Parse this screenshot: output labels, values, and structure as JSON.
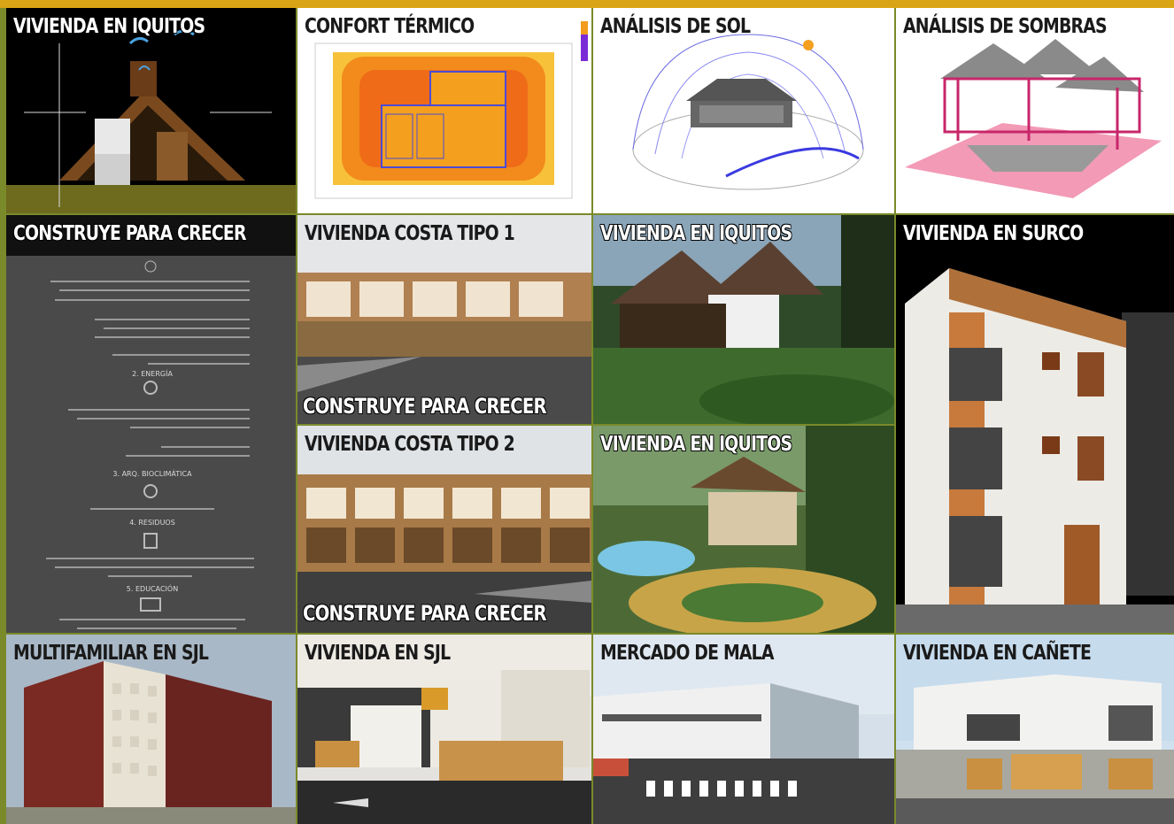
{
  "tiles": {
    "t1": {
      "title": "VIVIENDA EN IQUITOS"
    },
    "t2": {
      "title": "CONFORT TÉRMICO"
    },
    "t3": {
      "title": "ANÁLISIS DE SOL"
    },
    "t4": {
      "title": "ANÁLISIS DE SOMBRAS"
    },
    "t5": {
      "title": "CONSTRUYE PARA CRECER",
      "sections": [
        "2. ENERGÍA",
        "3. ARQ. BIOCLIMÁTICA",
        "4. RESIDUOS",
        "5. EDUCACIÓN"
      ]
    },
    "t6": {
      "title": "VIVIENDA COSTA TIPO 1",
      "caption": "CONSTRUYE PARA CRECER"
    },
    "t7": {
      "title": "VIVIENDA EN IQUITOS"
    },
    "t8": {
      "title": "VIVIENDA EN SURCO"
    },
    "t9": {
      "title": "VIVIENDA COSTA TIPO 2",
      "caption": "CONSTRUYE PARA CRECER"
    },
    "t10": {
      "title": "VIVIENDA EN IQUITOS"
    },
    "t11": {
      "title": "MULTIFAMILIAR EN SJL"
    },
    "t12": {
      "title": "VIVIENDA EN SJL"
    },
    "t13": {
      "title": "MERCADO DE MALA"
    },
    "t14": {
      "title": "VIVIENDA EN CAÑETE"
    }
  },
  "colors": {
    "top_bar": "#d9a514",
    "frame": "#7a8a2a"
  }
}
